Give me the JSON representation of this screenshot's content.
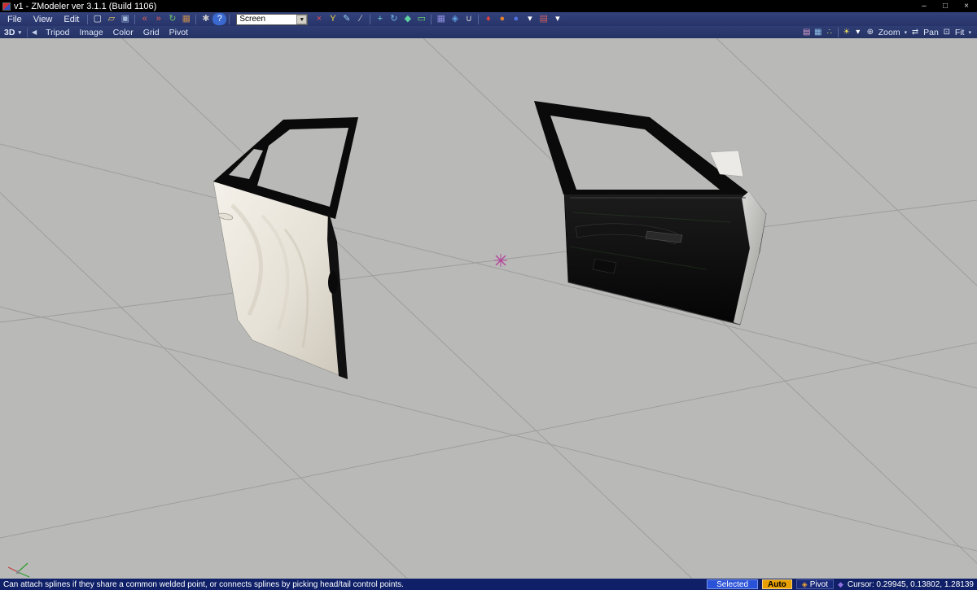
{
  "colors": {
    "titlebar": "#000000",
    "toolbar": "#2b3a6e",
    "viewport_bg": "#b9bab8",
    "grid_line": "#9a9a9a",
    "statusbar": "#0f2068",
    "selected_badge": "#2a52d8",
    "auto_badge": "#e8a000",
    "origin_marker": "#b5489b"
  },
  "glyphs": {
    "caret": "▾",
    "back": "◀",
    "dropdown": "▼",
    "zoom": "⊕",
    "pan": "⇄",
    "fit": "⊡",
    "pivot": "◈",
    "cursor_diamond": "◆"
  },
  "window": {
    "title": "v1 - ZModeler ver 3.1.1 (Build 1106)",
    "minimize": "–",
    "maximize": "□",
    "close": "×"
  },
  "menubar": {
    "items": [
      {
        "name": "menu-file",
        "label": "File"
      },
      {
        "name": "menu-view",
        "label": "View"
      },
      {
        "name": "menu-edit",
        "label": "Edit"
      }
    ]
  },
  "toolbar": {
    "screen_mode": "Screen",
    "icons_left": [
      {
        "name": "new-file-icon",
        "glyph": "▢",
        "color": "#e8e8e8"
      },
      {
        "name": "open-folder-icon",
        "glyph": "▱",
        "color": "#e8c96a"
      },
      {
        "name": "save-icon",
        "glyph": "▣",
        "color": "#9fb6d8"
      },
      {
        "type": "sep"
      },
      {
        "name": "import-icon",
        "glyph": "«",
        "color": "#e06050"
      },
      {
        "name": "export-icon",
        "glyph": "»",
        "color": "#e06050"
      },
      {
        "name": "refresh-icon",
        "glyph": "↻",
        "color": "#6cc06c"
      },
      {
        "name": "package-icon",
        "glyph": "▦",
        "color": "#c08a50"
      },
      {
        "type": "sep"
      },
      {
        "name": "settings-gear-icon",
        "glyph": "✱",
        "color": "#c8c8c8"
      },
      {
        "name": "help-icon",
        "glyph": "?",
        "color": "#ffffff",
        "bg": "#3a6ad0"
      },
      {
        "type": "sep"
      }
    ],
    "icons_right": [
      {
        "name": "delete-icon",
        "glyph": "×",
        "color": "#e05050"
      },
      {
        "name": "y-axis-icon",
        "glyph": "Y",
        "color": "#e8d040"
      },
      {
        "name": "draw-pencil-icon",
        "glyph": "✎",
        "color": "#9ad0f0"
      },
      {
        "name": "line-tool-icon",
        "glyph": "∕",
        "color": "#cccccc"
      },
      {
        "type": "sep"
      },
      {
        "name": "move-tool-icon",
        "glyph": "+",
        "color": "#70d8d8"
      },
      {
        "name": "rotate-tool-icon",
        "glyph": "↻",
        "color": "#70b8e8"
      },
      {
        "name": "scale-tool-icon",
        "glyph": "◆",
        "color": "#5fd0a0"
      },
      {
        "name": "display-monitor-icon",
        "glyph": "▭",
        "color": "#70e070"
      },
      {
        "type": "sep"
      },
      {
        "name": "grid-snap-icon",
        "glyph": "▦",
        "color": "#9090e0"
      },
      {
        "name": "vertex-snap-icon",
        "glyph": "◈",
        "color": "#60a0e0"
      },
      {
        "name": "edge-snap-icon",
        "glyph": "∪",
        "color": "#d0d0d0"
      },
      {
        "type": "sep"
      },
      {
        "name": "render-icon",
        "glyph": "♦",
        "color": "#e04040"
      },
      {
        "name": "material-orange-icon",
        "glyph": "●",
        "color": "#e08030"
      },
      {
        "name": "material-blue-icon",
        "glyph": "●",
        "color": "#5070e0"
      },
      {
        "name": "dropdown-caret-icon",
        "glyph": "▾",
        "color": "#ffffff"
      },
      {
        "name": "palette-icon",
        "glyph": "▤",
        "color": "#d06060"
      },
      {
        "name": "dropdown-caret2-icon",
        "glyph": "▾",
        "color": "#ffffff"
      }
    ]
  },
  "viewportbar": {
    "view_label": "3D",
    "menus": [
      {
        "name": "viewport-menu-tripod",
        "label": "Tripod"
      },
      {
        "name": "viewport-menu-image",
        "label": "Image"
      },
      {
        "name": "viewport-menu-color",
        "label": "Color"
      },
      {
        "name": "viewport-menu-grid",
        "label": "Grid"
      },
      {
        "name": "viewport-menu-pivot",
        "label": "Pivot"
      }
    ],
    "right_icons": [
      {
        "name": "shading-mode-icon",
        "glyph": "▤",
        "color": "#e0a0d0"
      },
      {
        "name": "wireframe-icon",
        "glyph": "▦",
        "color": "#90c0e8"
      },
      {
        "name": "vertices-icon",
        "glyph": "∴",
        "color": "#e8e870"
      },
      {
        "type": "sep"
      },
      {
        "name": "light-bulb-icon",
        "glyph": "☀",
        "color": "#f0e060"
      },
      {
        "name": "display-caret-icon",
        "glyph": "▾",
        "color": "#ffffff"
      }
    ],
    "zoom_label": "Zoom",
    "pan_label": "Pan",
    "fit_label": "Fit"
  },
  "statusbar": {
    "message": "Can attach splines if they share a common welded point, or connects splines by picking head/tail control points.",
    "selected_label": "Selected",
    "auto_label": "Auto",
    "pivot_label": "Pivot",
    "cursor_label": "Cursor: 0.29945, 0.13802, 1.28139"
  }
}
